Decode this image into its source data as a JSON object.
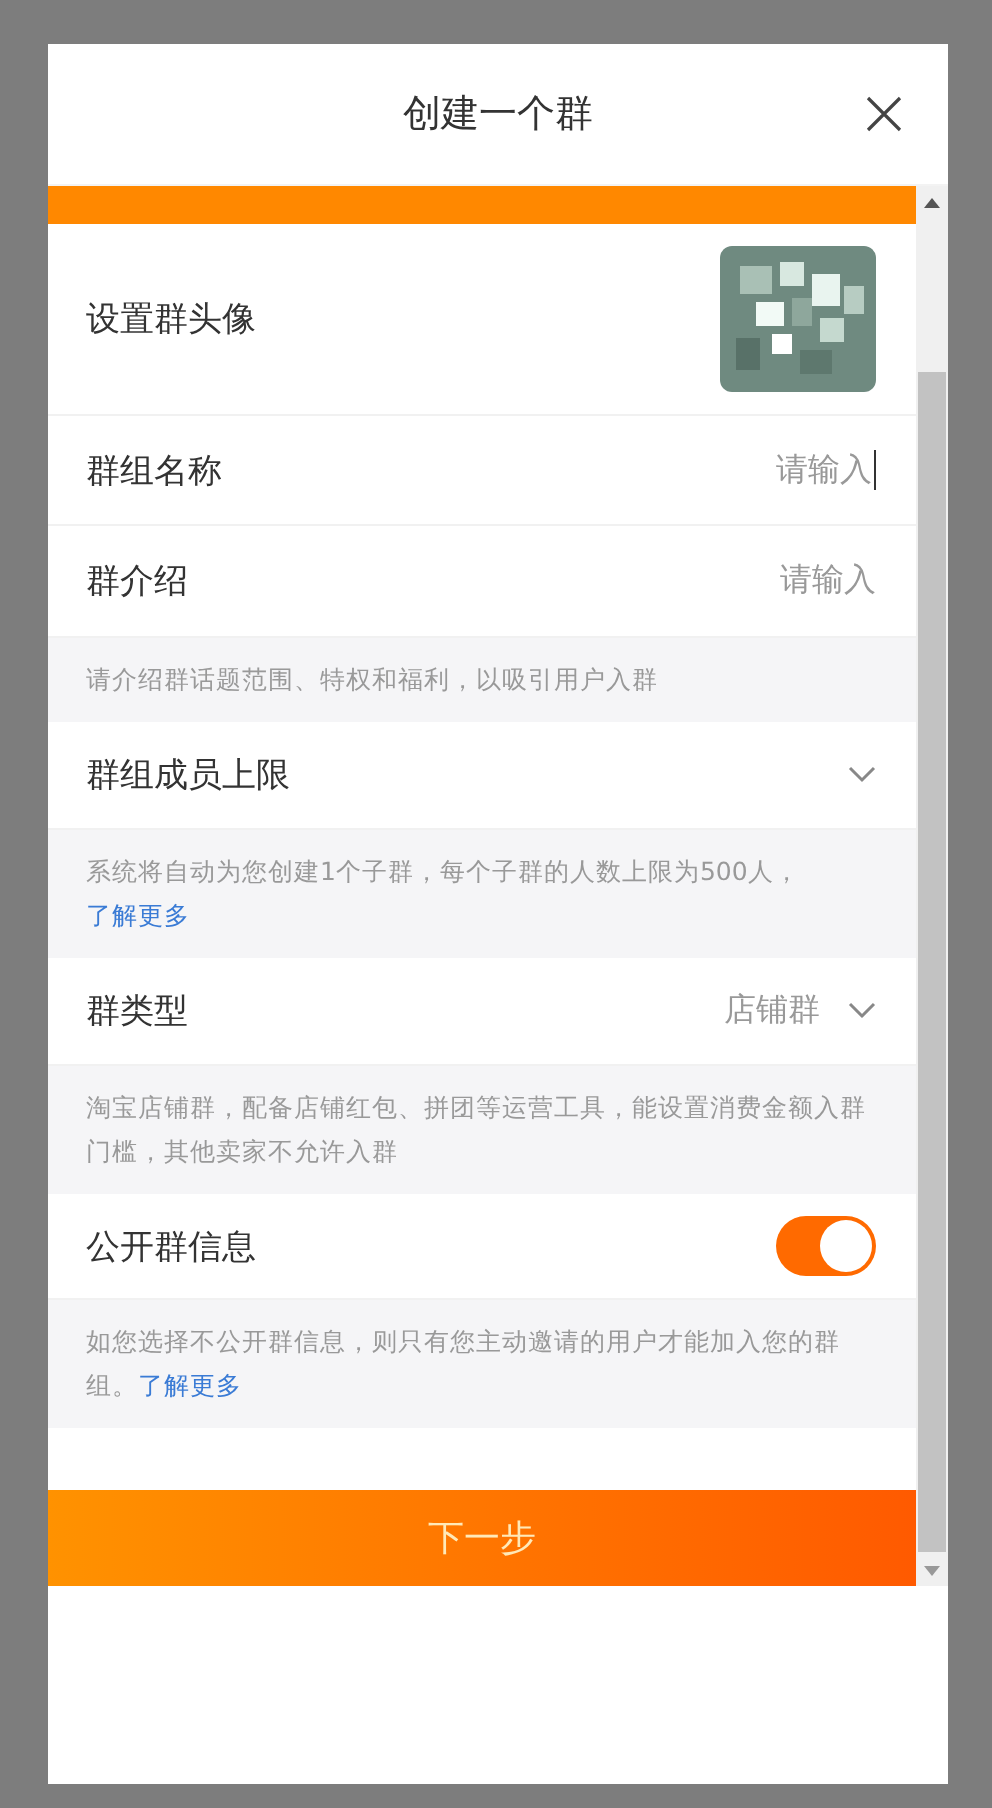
{
  "dialog": {
    "title": "创建一个群"
  },
  "rows": [
    {
      "kind": "avatar",
      "label": "设置群头像"
    },
    {
      "kind": "input",
      "label": "群组名称",
      "placeholder": "请输入",
      "focused": true
    },
    {
      "kind": "input",
      "label": "群介绍",
      "placeholder": "请输入",
      "focused": false
    },
    {
      "kind": "hint",
      "text": "请介绍群话题范围、特权和福利，以吸引用户入群"
    },
    {
      "kind": "select",
      "label": "群组成员上限"
    },
    {
      "kind": "hint",
      "text": "系统将自动为您创建1个子群，每个子群的人数上限为500人，",
      "link": "了解更多"
    },
    {
      "kind": "select",
      "label": "群类型",
      "value": "店铺群"
    },
    {
      "kind": "hint",
      "text": "淘宝店铺群，配备店铺红包、拼团等运营工具，能设置消费金额入群门槛，其他卖家不允许入群"
    },
    {
      "kind": "toggle",
      "label": "公开群信息",
      "on": true
    },
    {
      "kind": "hint",
      "text": "如您选择不公开群信息，则只有您主动邀请的用户才能加入您的群组。",
      "link": "了解更多"
    }
  ],
  "next_button": "下一步"
}
